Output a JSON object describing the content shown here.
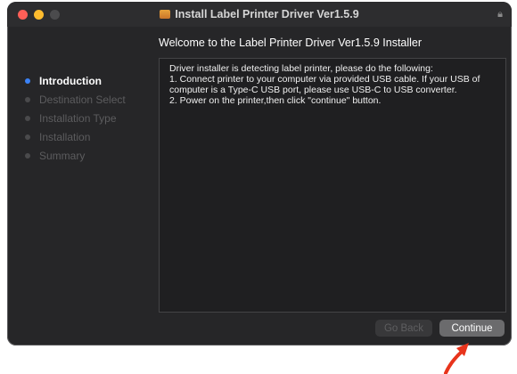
{
  "window": {
    "title": "Install Label Printer Driver Ver1.5.9"
  },
  "heading": "Welcome to the Label Printer Driver Ver1.5.9 Installer",
  "sidebar": {
    "steps": [
      {
        "label": "Introduction",
        "active": true
      },
      {
        "label": "Destination Select",
        "active": false
      },
      {
        "label": "Installation Type",
        "active": false
      },
      {
        "label": "Installation",
        "active": false
      },
      {
        "label": "Summary",
        "active": false
      }
    ]
  },
  "content": {
    "lines": [
      "Driver installer is detecting label printer, please do the following:",
      "1. Connect printer to your computer via provided USB cable. If your USB of computer is a Type-C USB port, please use USB-C to USB converter.",
      "2. Power on the printer,then click \"continue\" button."
    ]
  },
  "buttons": {
    "back": "Go Back",
    "continue": "Continue"
  },
  "colors": {
    "accent": "#3b82f6",
    "annotation_arrow": "#e8341c"
  },
  "icons": {
    "title": "package-icon",
    "lock": "lock-icon"
  }
}
